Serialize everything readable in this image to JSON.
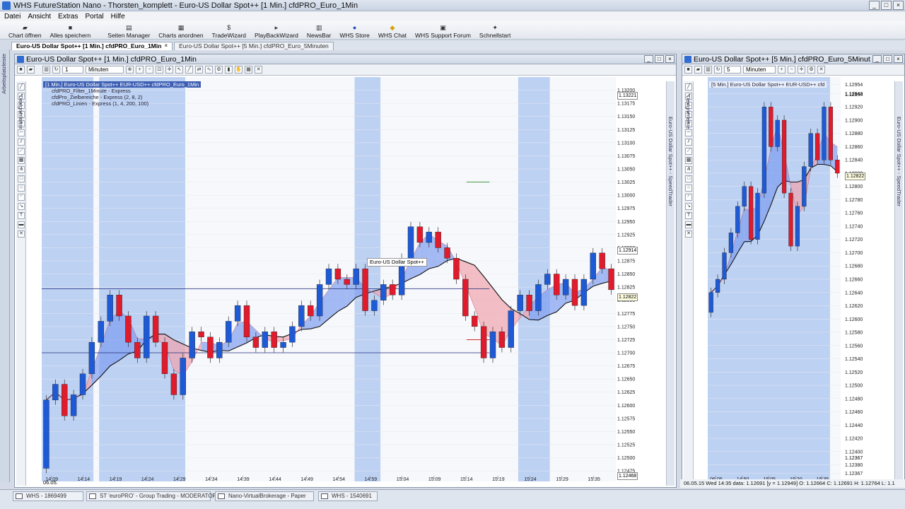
{
  "app": {
    "title": "WHS FutureStation Nano - Thorsten_komplett - Euro-US Dollar Spot++ [1 Min.]  cfdPRO_Euro_1Min",
    "window_buttons": [
      "_",
      "□",
      "×"
    ]
  },
  "menu": [
    "Datei",
    "Ansicht",
    "Extras",
    "Portal",
    "Hilfe"
  ],
  "toolbar": [
    {
      "label": "Chart öffnen",
      "icon": "folder-icon"
    },
    {
      "label": "Alles speichern",
      "icon": "save-icon"
    },
    {
      "label": "Seiten Manager",
      "icon": "pages-icon"
    },
    {
      "label": "Charts anordnen",
      "icon": "grid-icon"
    },
    {
      "label": "TradeWizard",
      "icon": "dollar-icon"
    },
    {
      "label": "PlayBackWizard",
      "icon": "playback-icon"
    },
    {
      "label": "NewsBar",
      "icon": "news-icon"
    },
    {
      "label": "WHS Store",
      "icon": "store-icon"
    },
    {
      "label": "WHS Chat",
      "icon": "chat-icon"
    },
    {
      "label": "WHS Support Forum",
      "icon": "forum-icon"
    },
    {
      "label": "Schnellstart",
      "icon": "run-icon"
    }
  ],
  "tabs": [
    {
      "label": "Euro-US Dollar Spot++ [1 Min.]  cfdPRO_Euro_1Min",
      "active": true,
      "close": "×"
    },
    {
      "label": "Euro-US Dollar Spot++ [5 Min.]  cfdPRO_Euro_5Minuten",
      "active": false
    }
  ],
  "left_vertical_label": "Arbeitsplatzleiste",
  "chart1": {
    "title": "Euro-US Dollar Spot++ [1 Min.]  cfdPRO_Euro_1Min",
    "interval_value": "1",
    "interval_unit": "Minuten",
    "designer_label": "Designerleiste",
    "speedtrader_label": "Euro-US Dollar Spot++ - SpeedTrader",
    "legend": [
      "[1 Min.] Euro-US Dollar Spot++  EUR-USD++ cfdPRO_Euro_1Min",
      "cfdPRO_Filter_1Minute - Express",
      "cfdPro_Zielbereiche - Express  (2, 8, 2)",
      "cfdPRO_Linien - Express  (1, 4, 200, 100)"
    ],
    "tooltip": "Euro-US Dollar Spot++",
    "price_badges": {
      "top": "1.13221",
      "mid": "1.12914",
      "current": "1.12822",
      "bottom": "1.12468"
    },
    "date_label": "06.05."
  },
  "chart2": {
    "title": "Euro-US Dollar Spot++ [5 Min.]  cfdPRO_Euro_5Minuten",
    "interval_value": "5",
    "interval_unit": "Minuten",
    "designer_label": "Designerleiste",
    "speedtrader_label": "Euro-US Dollar Spot++ - SpeedTrader",
    "legend": [
      "[5 Min.] Euro-US Dollar Spot++  EUR-USD++ cfd"
    ],
    "price_badges": {
      "top": "1.12954",
      "current": "1.12822",
      "bottom": "1.12367"
    },
    "date_label": "06.05.",
    "status": "06.05.15 Wed 14:35 data: 1.12691 [y = 1.12949]   O: 1.12664 C: 1.12691 H: 1.12764 L: 1.1"
  },
  "taskbar": [
    "WHS - 1869499",
    "ST 'euroPRO' - Group Trading - MODERATOR",
    "Nano-VirtualBrokerage - Paper",
    "WHS - 1540691"
  ],
  "chart_data": [
    {
      "type": "candlestick",
      "title": "Euro-US Dollar Spot++ [1 Min.]  cfdPRO_Euro_1Min",
      "xlabel": "",
      "ylabel": "",
      "y_ticks": [
        "1.13200",
        "1.13175",
        "1.13150",
        "1.13125",
        "1.13100",
        "1.13075",
        "1.13050",
        "1.13025",
        "1.13000",
        "1.12975",
        "1.12950",
        "1.12925",
        "1.12900",
        "1.12875",
        "1.12850",
        "1.12825",
        "1.12800",
        "1.12775",
        "1.12750",
        "1.12725",
        "1.12700",
        "1.12675",
        "1.12650",
        "1.12625",
        "1.12600",
        "1.12575",
        "1.12550",
        "1.12525",
        "1.12500",
        "1.12475"
      ],
      "x_ticks": [
        "14:09",
        "14:14",
        "14:19",
        "14:24",
        "14:29",
        "14:34",
        "14:39",
        "14:44",
        "14:49",
        "14:54",
        "14:59",
        "15:04",
        "15:09",
        "15:14",
        "15:19",
        "15:24",
        "15:29",
        "15:35"
      ],
      "ylim": [
        1.12455,
        1.13225
      ],
      "closes": [
        1.1261,
        1.1264,
        1.1258,
        1.1262,
        1.1266,
        1.1272,
        1.1276,
        1.1281,
        1.1277,
        1.1272,
        1.1269,
        1.1277,
        1.1272,
        1.1266,
        1.1262,
        1.1269,
        1.1274,
        1.1273,
        1.1269,
        1.1272,
        1.1276,
        1.1279,
        1.1273,
        1.1271,
        1.1274,
        1.1271,
        1.1272,
        1.1275,
        1.1279,
        1.1277,
        1.1283,
        1.1286,
        1.1284,
        1.1283,
        1.1286,
        1.1278,
        1.128,
        1.1283,
        1.1281,
        1.1288,
        1.1294,
        1.1291,
        1.1293,
        1.129,
        1.1288,
        1.1284,
        1.1277,
        1.1275,
        1.1269,
        1.1274,
        1.1271,
        1.1278,
        1.1281,
        1.1278,
        1.1283,
        1.1285,
        1.1281,
        1.1284,
        1.1279,
        1.1284,
        1.1289,
        1.1286,
        1.1282
      ],
      "opens": [
        1.1248,
        1.1261,
        1.1264,
        1.1258,
        1.1262,
        1.1266,
        1.1272,
        1.1276,
        1.1281,
        1.1277,
        1.1272,
        1.1269,
        1.1277,
        1.1272,
        1.1266,
        1.1262,
        1.1269,
        1.1274,
        1.1273,
        1.1269,
        1.1272,
        1.1276,
        1.1279,
        1.1273,
        1.1271,
        1.1274,
        1.1271,
        1.1272,
        1.1275,
        1.1279,
        1.1277,
        1.1283,
        1.1286,
        1.1284,
        1.1283,
        1.1286,
        1.1278,
        1.128,
        1.1283,
        1.1281,
        1.1288,
        1.1294,
        1.1291,
        1.1293,
        1.129,
        1.1288,
        1.1284,
        1.1277,
        1.1275,
        1.1269,
        1.1274,
        1.1271,
        1.1278,
        1.1281,
        1.1278,
        1.1283,
        1.1285,
        1.1281,
        1.1284,
        1.1279,
        1.1284,
        1.1289,
        1.1286
      ],
      "horizontal_levels": [
        1.12822,
        1.127,
        1.13025,
        1.12725
      ]
    },
    {
      "type": "candlestick",
      "title": "Euro-US Dollar Spot++ [5 Min.]  cfdPRO_Euro_5Minuten",
      "xlabel": "",
      "ylabel": "",
      "y_ticks": [
        "1.12954",
        "1.12940",
        "1.12920",
        "1.12900",
        "1.12880",
        "1.12860",
        "1.12840",
        "1.12820",
        "1.12800",
        "1.12780",
        "1.12760",
        "1.12740",
        "1.12720",
        "1.12700",
        "1.12680",
        "1.12660",
        "1.12640",
        "1.12620",
        "1.12600",
        "1.12580",
        "1.12560",
        "1.12540",
        "1.12520",
        "1.12500",
        "1.12480",
        "1.12460",
        "1.12440",
        "1.12420",
        "1.12400",
        "1.12380",
        "1.12367"
      ],
      "x_ticks": [
        "06.05.",
        "14:50",
        "15:05",
        "15:20",
        "15:35"
      ],
      "ylim": [
        1.12355,
        1.12965
      ],
      "closes": [
        1.1264,
        1.1266,
        1.127,
        1.1273,
        1.1277,
        1.128,
        1.1272,
        1.1279,
        1.1292,
        1.1286,
        1.129,
        1.1279,
        1.1271,
        1.1277,
        1.1283,
        1.1288,
        1.1284,
        1.1292,
        1.1284,
        1.1282
      ],
      "opens": [
        1.1261,
        1.1264,
        1.1266,
        1.127,
        1.1273,
        1.1277,
        1.128,
        1.1272,
        1.1279,
        1.1292,
        1.1286,
        1.129,
        1.1279,
        1.1271,
        1.1277,
        1.1283,
        1.1288,
        1.1284,
        1.1292,
        1.1284
      ]
    }
  ]
}
